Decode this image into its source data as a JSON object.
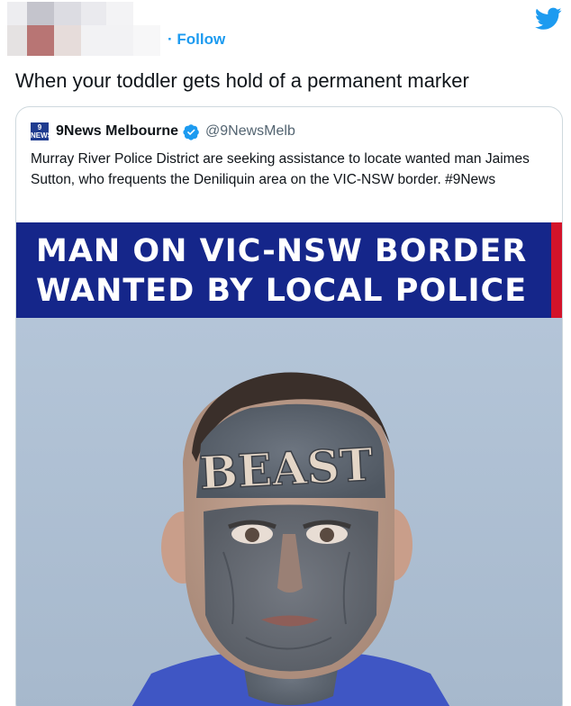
{
  "header": {
    "follow_label": "· Follow",
    "twitter_icon": "twitter-bird-icon",
    "bird_color": "#1d9bf0"
  },
  "tweet": {
    "text": "When your toddler gets hold of a permanent marker"
  },
  "quoted_tweet": {
    "logo_text": "9\nNEWS",
    "author_name": "9News Melbourne",
    "verified_icon": "verified-badge-icon",
    "handle": "@9NewsMelb",
    "body": "Murray River Police District are seeking assistance to locate wanted man Jaimes Sutton, who frequents the Deniliquin area on the VIC-NSW border. #9News",
    "banner_line_1": "MAN ON VIC-NSW BORDER",
    "banner_line_2": "WANTED BY LOCAL POLICE",
    "banner_color": "#15268a",
    "banner_accent": "#d3132a",
    "photo_forehead_text": "BEAST"
  }
}
